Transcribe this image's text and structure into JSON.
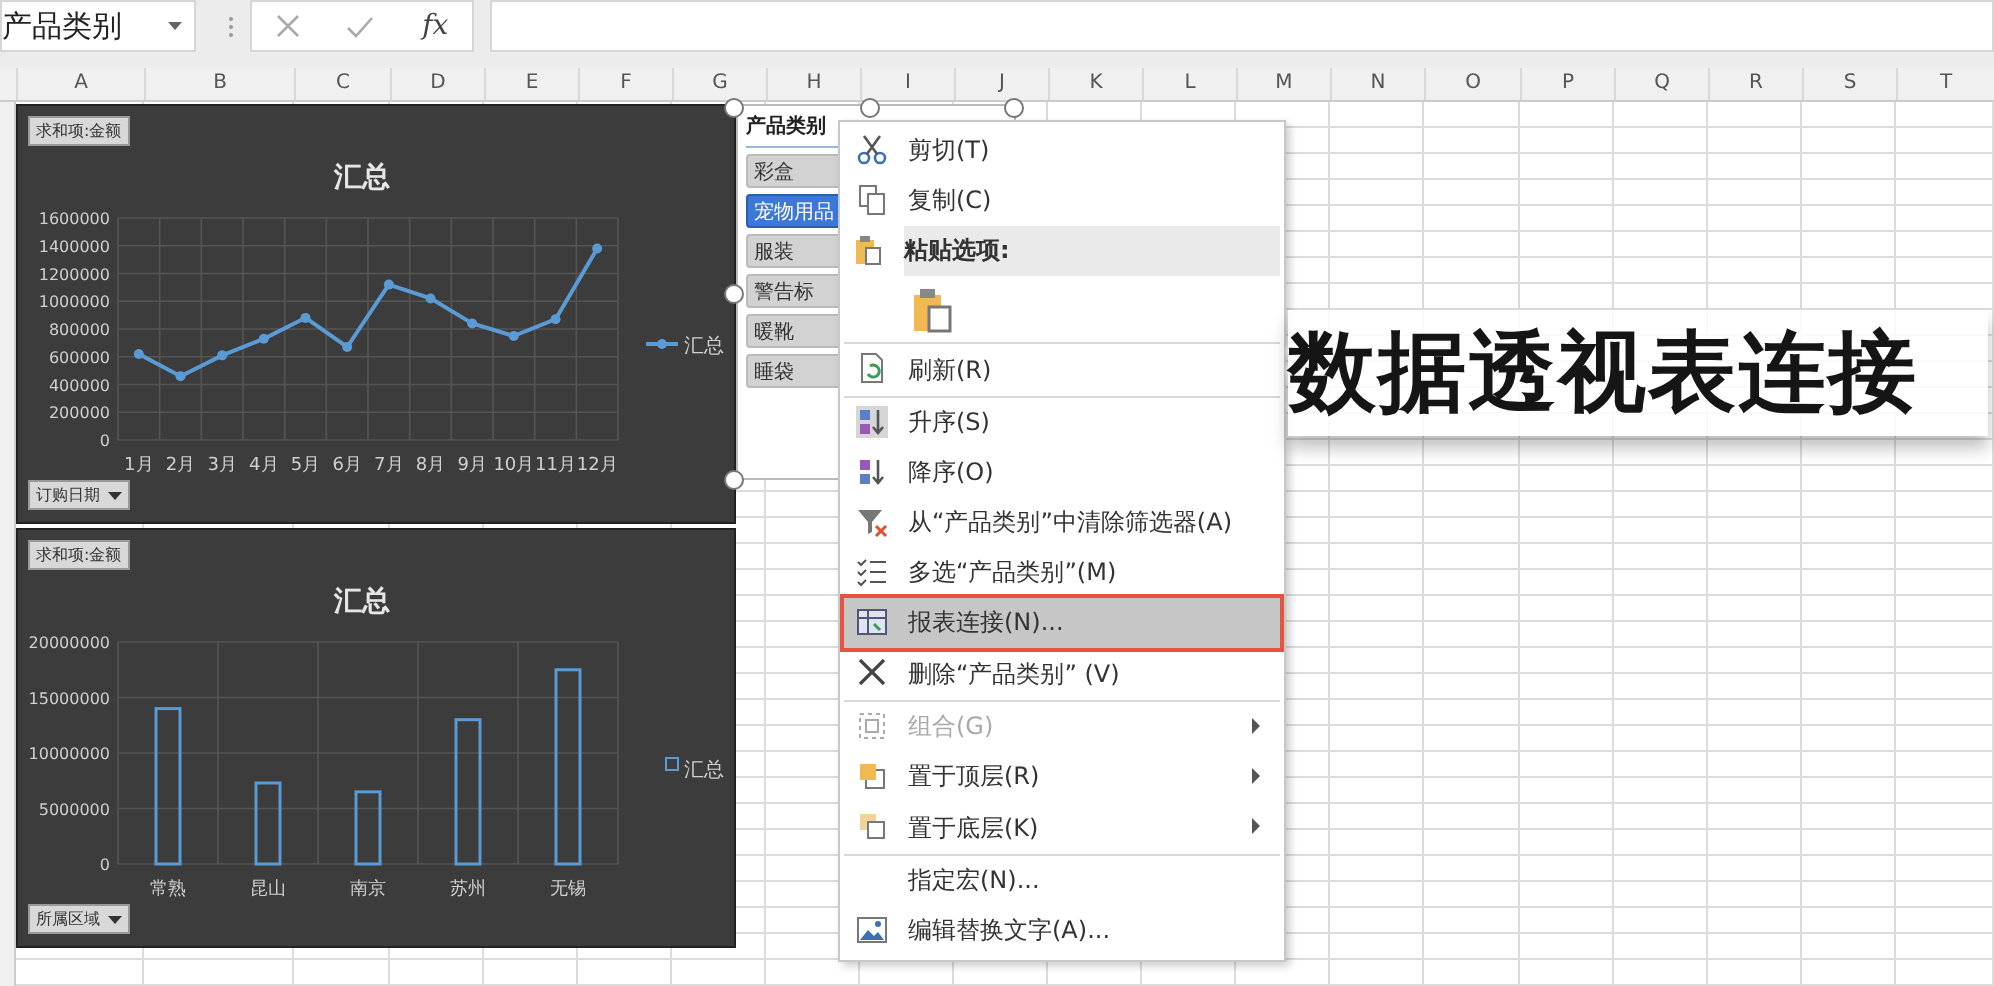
{
  "formula_bar": {
    "name_box": "产品类别",
    "function_label": "fx"
  },
  "columns": [
    "A",
    "B",
    "C",
    "D",
    "E",
    "F",
    "G",
    "H",
    "I",
    "J",
    "K",
    "L",
    "M",
    "N",
    "O",
    "P",
    "Q",
    "R",
    "S",
    "T"
  ],
  "charts": [
    {
      "filter_button": "求和项:金额",
      "axis_button": "订购日期",
      "chart_data": {
        "type": "line",
        "grid": true,
        "title": "汇总",
        "categories": [
          "1月",
          "2月",
          "3月",
          "4月",
          "5月",
          "6月",
          "7月",
          "8月",
          "9月",
          "10月",
          "11月",
          "12月"
        ],
        "series": [
          {
            "name": "汇总",
            "color": "#5b9bd5",
            "marker": "circle",
            "values": [
              620000,
              460000,
              610000,
              730000,
              880000,
              670000,
              1120000,
              1020000,
              840000,
              750000,
              870000,
              1380000
            ]
          }
        ],
        "ylim": [
          0,
          1600000
        ],
        "yticks": [
          0,
          200000,
          400000,
          600000,
          800000,
          1000000,
          1200000,
          1400000,
          1600000
        ]
      }
    },
    {
      "filter_button": "求和项:金额",
      "axis_button": "所属区域",
      "chart_data": {
        "type": "bar",
        "grid": true,
        "title": "汇总",
        "categories": [
          "常熟",
          "昆山",
          "南京",
          "苏州",
          "无锡"
        ],
        "series": [
          {
            "name": "汇总",
            "color": "#5b9bd5",
            "values": [
              14000000,
              7300000,
              6500000,
              13000000,
              17500000
            ]
          }
        ],
        "ylim": [
          0,
          20000000
        ],
        "yticks": [
          0,
          5000000,
          10000000,
          15000000,
          20000000
        ]
      }
    }
  ],
  "slicer": {
    "title": "产品类别",
    "items": [
      {
        "label": "彩盒",
        "selected": false
      },
      {
        "label": "宠物用品",
        "selected": true
      },
      {
        "label": "服装",
        "selected": false
      },
      {
        "label": "警告标",
        "selected": false
      },
      {
        "label": "暖靴",
        "selected": false
      },
      {
        "label": "睡袋",
        "selected": false
      }
    ]
  },
  "context_menu": {
    "items": [
      {
        "kind": "command",
        "label": "剪切(T)",
        "disabled": false,
        "selected": false,
        "has_submenu": false,
        "separator_after": false
      },
      {
        "kind": "command",
        "label": "复制(C)",
        "disabled": false,
        "selected": false,
        "has_submenu": false,
        "separator_after": false
      },
      {
        "kind": "header",
        "label": "粘贴选项:",
        "disabled": false,
        "selected": false,
        "has_submenu": false,
        "separator_after": false
      },
      {
        "kind": "paste-options",
        "disabled": false,
        "selected": false,
        "has_submenu": false,
        "separator_after": true
      },
      {
        "kind": "command",
        "label": "刷新(R)",
        "disabled": false,
        "selected": false,
        "has_submenu": false,
        "separator_after": true
      },
      {
        "kind": "command",
        "label": "升序(S)",
        "disabled": false,
        "selected": false,
        "has_submenu": false,
        "separator_after": false
      },
      {
        "kind": "command",
        "label": "降序(O)",
        "disabled": false,
        "selected": false,
        "has_submenu": false,
        "separator_after": false
      },
      {
        "kind": "command",
        "label": "从“产品类别”中清除筛选器(A)",
        "disabled": false,
        "selected": false,
        "has_submenu": false,
        "separator_after": false
      },
      {
        "kind": "command",
        "label": "多选“产品类别”(M)",
        "disabled": false,
        "selected": false,
        "has_submenu": false,
        "separator_after": false
      },
      {
        "kind": "command",
        "label": "报表连接(N)...",
        "disabled": false,
        "selected": true,
        "has_submenu": false,
        "separator_after": false
      },
      {
        "kind": "command",
        "label": "删除“产品类别” (V)",
        "disabled": false,
        "selected": false,
        "has_submenu": false,
        "separator_after": true
      },
      {
        "kind": "command",
        "label": "组合(G)",
        "disabled": true,
        "selected": false,
        "has_submenu": true,
        "separator_after": false
      },
      {
        "kind": "command",
        "label": "置于顶层(R)",
        "disabled": false,
        "selected": false,
        "has_submenu": true,
        "separator_after": false
      },
      {
        "kind": "command",
        "label": "置于底层(K)",
        "disabled": false,
        "selected": false,
        "has_submenu": true,
        "separator_after": true
      },
      {
        "kind": "command",
        "label": "指定宏(N)...",
        "disabled": false,
        "selected": false,
        "has_submenu": false,
        "separator_after": false
      },
      {
        "kind": "command",
        "label": "编辑替换文字(A)...",
        "disabled": false,
        "selected": false,
        "has_submenu": false,
        "separator_after": false
      }
    ]
  },
  "caption": "数据透视表连接"
}
